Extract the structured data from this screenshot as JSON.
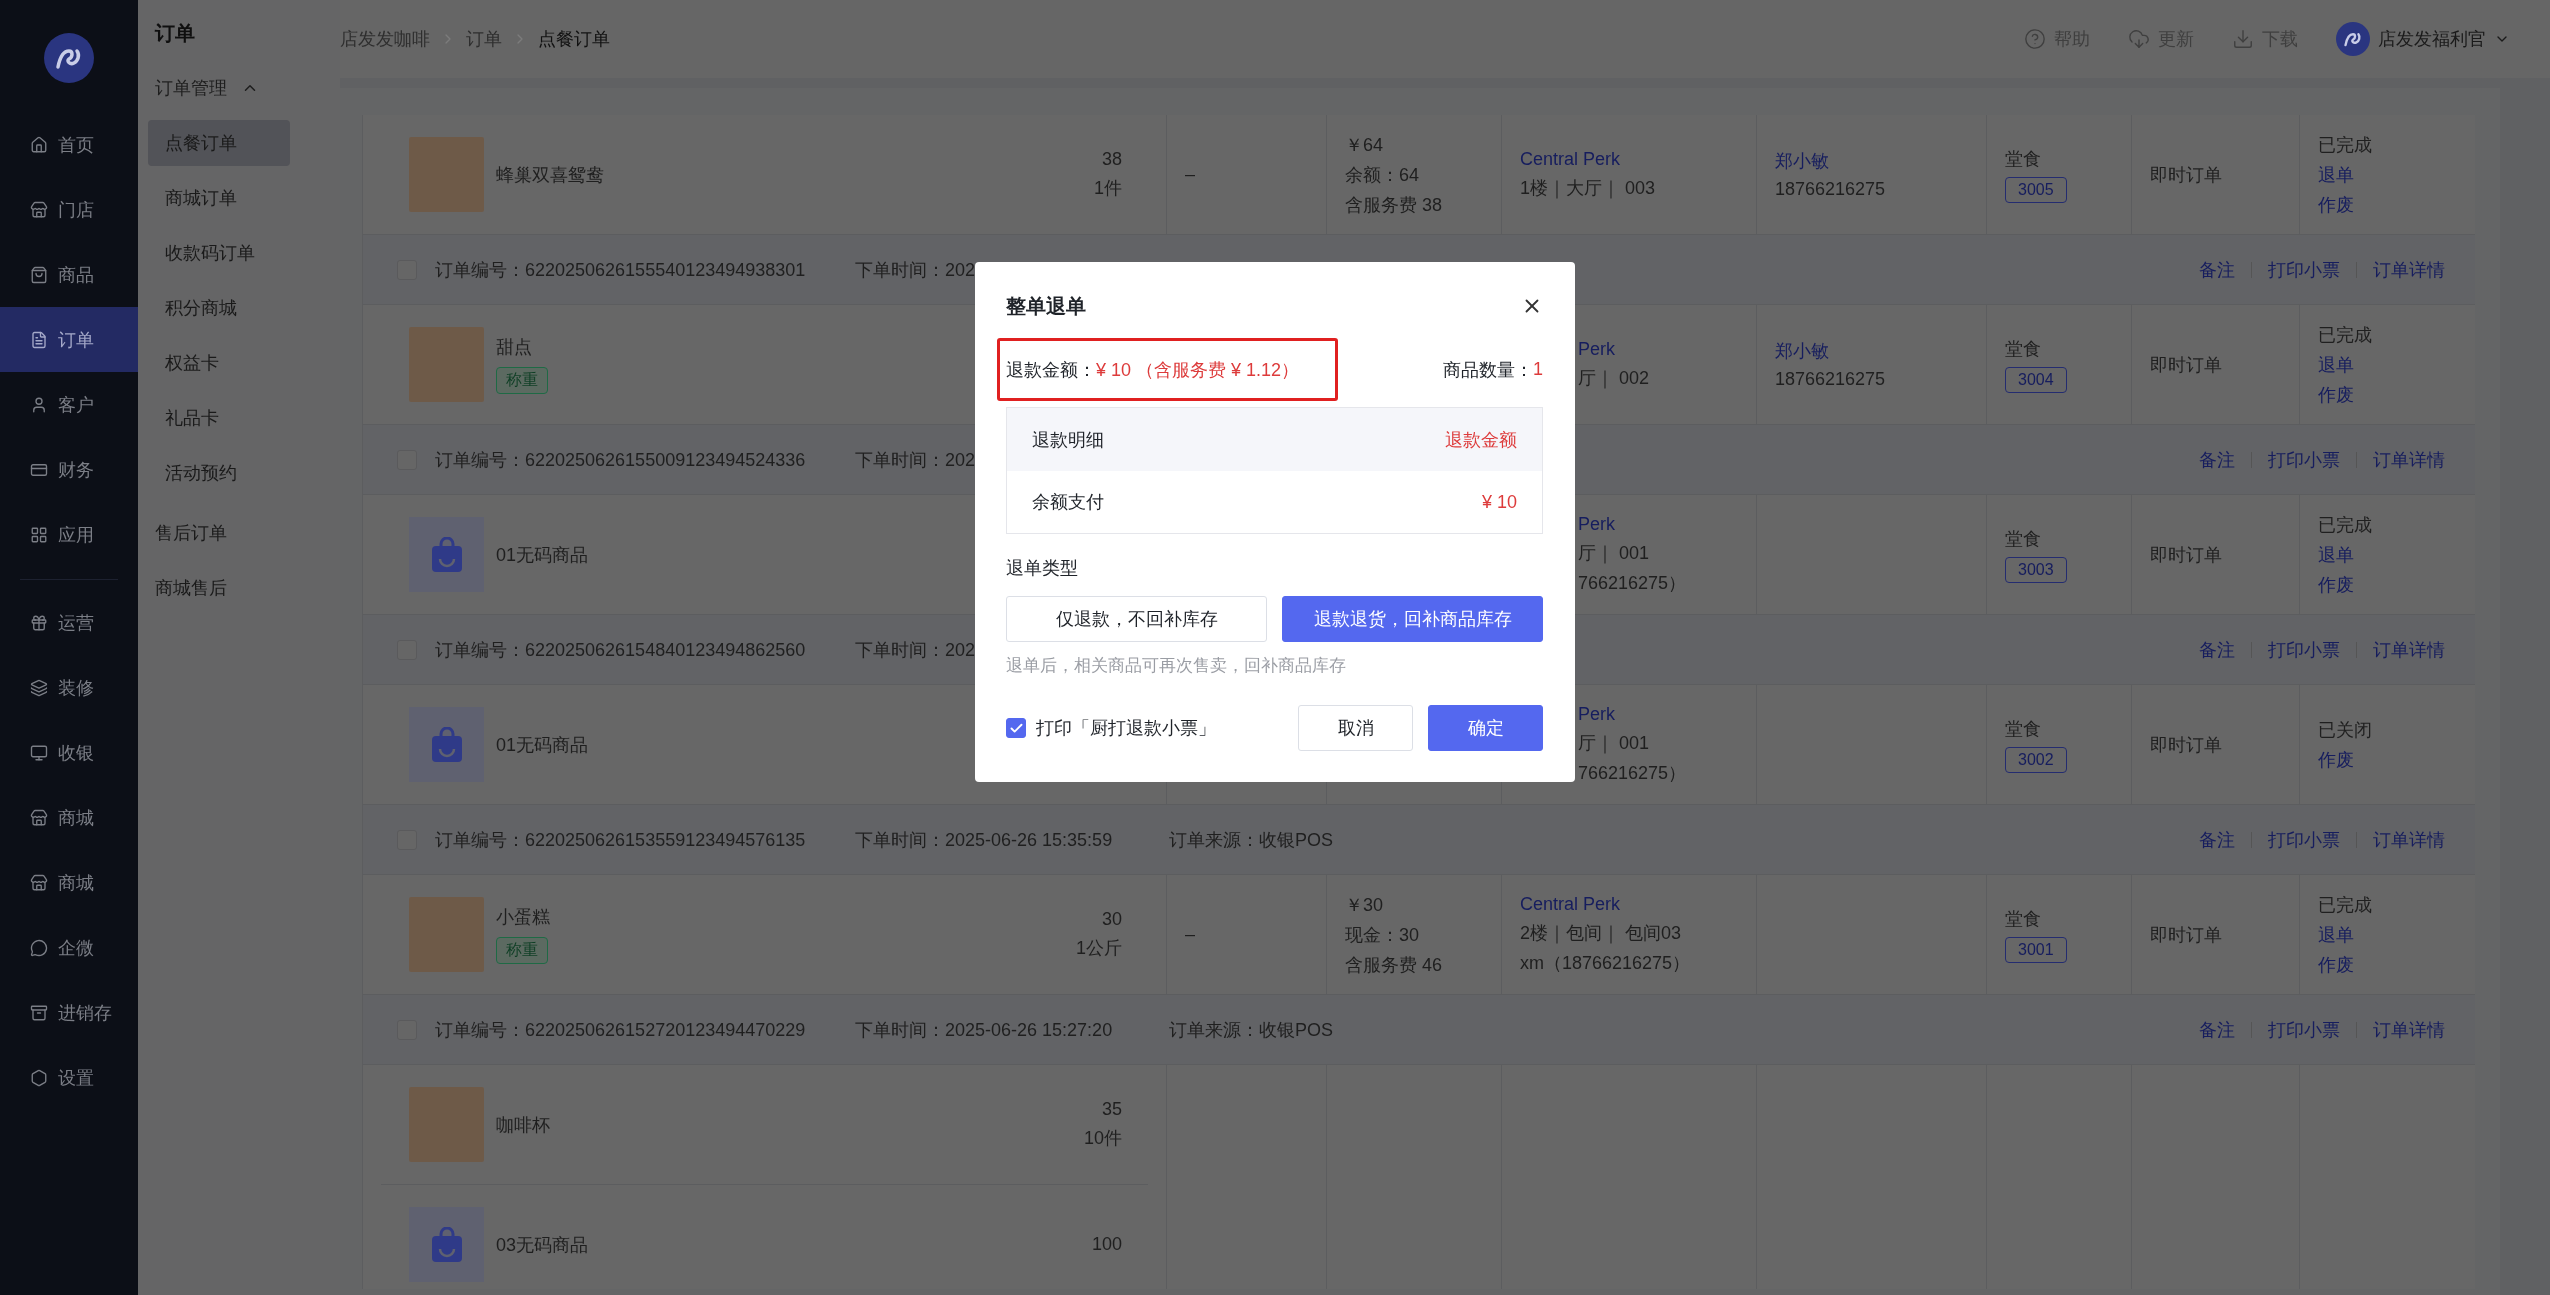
{
  "sidebar": {
    "sections": [
      {
        "items": [
          {
            "label": "首页",
            "selected": false
          },
          {
            "label": "门店",
            "selected": false
          },
          {
            "label": "商品",
            "selected": false
          },
          {
            "label": "订单",
            "selected": true
          },
          {
            "label": "客户",
            "selected": false
          },
          {
            "label": "财务",
            "selected": false
          },
          {
            "label": "应用",
            "selected": false
          }
        ]
      },
      {
        "items": [
          {
            "label": "运营",
            "selected": false
          },
          {
            "label": "装修",
            "selected": false
          },
          {
            "label": "收银",
            "selected": false
          },
          {
            "label": "商城",
            "selected": false
          },
          {
            "label": "商城",
            "selected": false
          },
          {
            "label": "企微",
            "selected": false
          },
          {
            "label": "进销存",
            "selected": false
          },
          {
            "label": "设置",
            "selected": false
          }
        ]
      }
    ]
  },
  "submenu": {
    "title": "订单",
    "items": [
      {
        "kind": "group",
        "label": "订单管理",
        "expanded": true,
        "children": [
          {
            "label": "点餐订单",
            "selected": true
          },
          {
            "label": "商城订单",
            "selected": false
          },
          {
            "label": "收款码订单",
            "selected": false
          },
          {
            "label": "积分商城",
            "selected": false
          },
          {
            "label": "权益卡",
            "selected": false
          },
          {
            "label": "礼品卡",
            "selected": false
          },
          {
            "label": "活动预约",
            "selected": false
          }
        ]
      },
      {
        "kind": "link",
        "label": "售后订单",
        "selected": false
      },
      {
        "kind": "link",
        "label": "商城售后",
        "selected": false
      }
    ]
  },
  "header": {
    "breadcrumb": [
      "店发发咖啡",
      "订单",
      "点餐订单"
    ],
    "actions": [
      "帮助",
      "更新",
      "下载"
    ],
    "user": "店发发福利官"
  },
  "table": {
    "rows": [
      {
        "kind": "items",
        "products": [
          {
            "kind": "photo",
            "name": "蜂巢双喜鸳鸯",
            "price": "38",
            "quantity": "1件"
          }
        ],
        "column_2": "–",
        "payment": [
          "￥64",
          "余额：64",
          "含服务费 38"
        ],
        "location": {
          "store": "Central Perk",
          "lines": [
            "1楼｜大厅｜ 003"
          ]
        },
        "customer": {
          "name": "郑小敏",
          "phone": "18766216275"
        },
        "dining": {
          "mode": "堂食",
          "number": "3005"
        },
        "order_type": "即时订单",
        "status": "已完成",
        "actions": [
          "退单",
          "作废"
        ]
      },
      {
        "kind": "order_header",
        "checked": false,
        "order_no": "订单编号：6220250626155540123494938301",
        "time": "下单时间：202",
        "actions": [
          "备注",
          "打印小票",
          "订单详情"
        ]
      },
      {
        "kind": "items",
        "partly_hidden": true,
        "products": [
          {
            "kind": "photo",
            "name": "甜点",
            "tag": "称重"
          }
        ],
        "location": {
          "store": "Perk",
          "lines": [
            "厅｜ 002"
          ]
        },
        "customer": {
          "name": "郑小敏",
          "phone": "18766216275"
        },
        "dining": {
          "mode": "堂食",
          "number": "3004"
        },
        "order_type": "即时订单",
        "status": "已完成",
        "actions": [
          "退单",
          "作废"
        ]
      },
      {
        "kind": "order_header",
        "checked": false,
        "order_no": "订单编号：6220250626155009123494524336",
        "time": "下单时间：202",
        "actions": [
          "备注",
          "打印小票",
          "订单详情"
        ]
      },
      {
        "kind": "items",
        "partly_hidden": true,
        "products": [
          {
            "kind": "no_code",
            "name": "01无码商品"
          }
        ],
        "location": {
          "store": "Perk",
          "lines": [
            "厅｜ 001",
            "766216275）"
          ]
        },
        "dining": {
          "mode": "堂食",
          "number": "3003"
        },
        "order_type": "即时订单",
        "status": "已完成",
        "actions": [
          "退单",
          "作废"
        ]
      },
      {
        "kind": "order_header",
        "checked": false,
        "order_no": "订单编号：6220250626154840123494862560",
        "time": "下单时间：202",
        "actions": [
          "备注",
          "打印小票",
          "订单详情"
        ]
      },
      {
        "kind": "items",
        "partly_hidden": true,
        "products": [
          {
            "kind": "no_code",
            "name": "01无码商品"
          }
        ],
        "location": {
          "store": "Perk",
          "lines": [
            "厅｜ 001",
            "766216275）"
          ]
        },
        "dining": {
          "mode": "堂食",
          "number": "3002"
        },
        "order_type": "即时订单",
        "status": "已关闭",
        "actions": [
          "作废"
        ]
      },
      {
        "kind": "order_header",
        "checked": false,
        "order_no": "订单编号：6220250626153559123494576135",
        "time": "下单时间：2025-06-26 15:35:59",
        "source": "订单来源：收银POS",
        "actions": [
          "备注",
          "打印小票",
          "订单详情"
        ]
      },
      {
        "kind": "items",
        "products": [
          {
            "kind": "photo",
            "name": "小蛋糕",
            "tag": "称重",
            "price": "30",
            "quantity": "1公斤"
          }
        ],
        "column_2": "–",
        "payment": [
          "￥30",
          "现金：30",
          "含服务费 46"
        ],
        "location": {
          "store": "Central Perk",
          "lines": [
            "2楼｜包间｜ 包间03",
            "xm（18766216275）"
          ]
        },
        "dining": {
          "mode": "堂食",
          "number": "3001"
        },
        "order_type": "即时订单",
        "status": "已完成",
        "actions": [
          "退单",
          "作废"
        ]
      },
      {
        "kind": "order_header",
        "checked": false,
        "order_no": "订单编号：6220250626152720123494470229",
        "time": "下单时间：2025-06-26 15:27:20",
        "source": "订单来源：收银POS",
        "actions": [
          "备注",
          "打印小票",
          "订单详情"
        ]
      },
      {
        "kind": "items",
        "products": [
          {
            "kind": "photo",
            "name": "咖啡杯",
            "price": "35",
            "quantity": "10件"
          },
          {
            "kind": "no_code",
            "name": "03无码商品",
            "price": "100"
          }
        ]
      }
    ]
  },
  "dialog": {
    "title": "整单退单",
    "highlighted": true,
    "refund_label": "退款金额：",
    "refund_value": "¥ 10 （含服务费 ¥ 1.12）",
    "count_label": "商品数量：",
    "count_value": "1",
    "detail_table": {
      "columns": [
        "退款明细",
        "退款金额"
      ],
      "rows": [
        [
          "余额支付",
          "¥ 10"
        ]
      ]
    },
    "type_label": "退单类型",
    "type_options": [
      {
        "label": "仅退款，不回补库存",
        "selected": false
      },
      {
        "label": "退款退货，回补商品库存",
        "selected": true
      }
    ],
    "hint": "退单后，相关商品可再次售卖，回补商品库存",
    "print_option": {
      "label": "打印「厨打退款小票」",
      "checked": true
    },
    "buttons": [
      {
        "label": "取消",
        "kind": "secondary"
      },
      {
        "label": "确定",
        "kind": "primary"
      }
    ]
  }
}
